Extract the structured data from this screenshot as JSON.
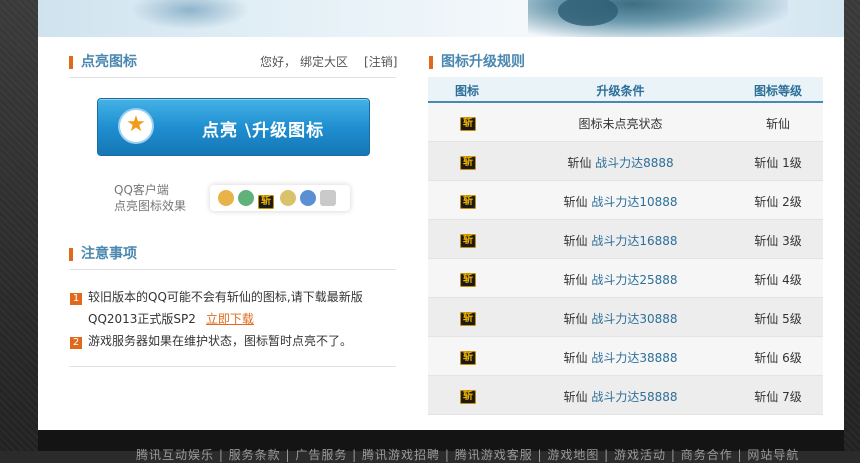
{
  "left": {
    "icon_section_title": "点亮图标",
    "greeting": "您好，",
    "bind_zone": "绑定大区",
    "logout": "[注销]",
    "light_button_label": "点亮 \\升级图标",
    "preview_line1": "QQ客户端",
    "preview_line2": "点亮图标效果",
    "notes_title": "注意事项",
    "notes": [
      {
        "num": "1",
        "text": "较旧版本的QQ可能不会有斩仙的图标,请下载最新版"
      },
      {
        "num": "",
        "text": "QQ2013正式版SP2",
        "link": "立即下载"
      },
      {
        "num": "2",
        "text": "游戏服务器如果在维护状态，图标暂时点亮不了。"
      }
    ]
  },
  "right": {
    "title": "图标升级规则",
    "columns": [
      "图标",
      "升级条件",
      "图标等级"
    ],
    "icon_glyph": "斩",
    "rows": [
      {
        "cond": "图标未点亮状态",
        "power": "",
        "level": "斩仙"
      },
      {
        "cond": "斩仙 ",
        "power": "战斗力达8888",
        "level": "斩仙 1级"
      },
      {
        "cond": "斩仙 ",
        "power": "战斗力达10888",
        "level": "斩仙 2级"
      },
      {
        "cond": "斩仙 ",
        "power": "战斗力达16888",
        "level": "斩仙 3级"
      },
      {
        "cond": "斩仙 ",
        "power": "战斗力达25888",
        "level": "斩仙 4级"
      },
      {
        "cond": "斩仙 ",
        "power": "战斗力达30888",
        "level": "斩仙 5级"
      },
      {
        "cond": "斩仙 ",
        "power": "战斗力达38888",
        "level": "斩仙 6级"
      },
      {
        "cond": "斩仙 ",
        "power": "战斗力达58888",
        "level": "斩仙 7级"
      }
    ]
  },
  "footer": {
    "links": "腾讯互动娱乐 | 服务条款 | 广告服务 | 腾讯游戏招聘 | 腾讯游戏客服 | 游戏地图 | 游戏活动 | 商务合作 | 网站导航"
  },
  "colors": {
    "accent": "#4a88b0",
    "orange": "#e06a1c",
    "button": "#1f8fd0"
  }
}
